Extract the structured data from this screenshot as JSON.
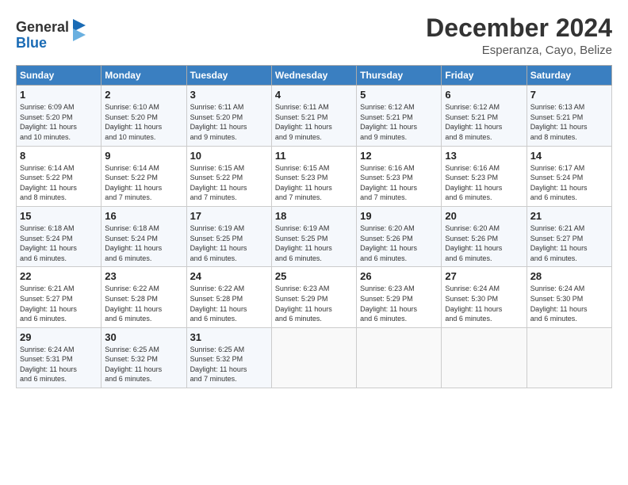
{
  "header": {
    "logo_line1": "General",
    "logo_line2": "Blue",
    "month": "December 2024",
    "location": "Esperanza, Cayo, Belize"
  },
  "days_of_week": [
    "Sunday",
    "Monday",
    "Tuesday",
    "Wednesday",
    "Thursday",
    "Friday",
    "Saturday"
  ],
  "weeks": [
    [
      {
        "day": "1",
        "text": "Sunrise: 6:09 AM\nSunset: 5:20 PM\nDaylight: 11 hours\nand 10 minutes."
      },
      {
        "day": "2",
        "text": "Sunrise: 6:10 AM\nSunset: 5:20 PM\nDaylight: 11 hours\nand 10 minutes."
      },
      {
        "day": "3",
        "text": "Sunrise: 6:11 AM\nSunset: 5:20 PM\nDaylight: 11 hours\nand 9 minutes."
      },
      {
        "day": "4",
        "text": "Sunrise: 6:11 AM\nSunset: 5:21 PM\nDaylight: 11 hours\nand 9 minutes."
      },
      {
        "day": "5",
        "text": "Sunrise: 6:12 AM\nSunset: 5:21 PM\nDaylight: 11 hours\nand 9 minutes."
      },
      {
        "day": "6",
        "text": "Sunrise: 6:12 AM\nSunset: 5:21 PM\nDaylight: 11 hours\nand 8 minutes."
      },
      {
        "day": "7",
        "text": "Sunrise: 6:13 AM\nSunset: 5:21 PM\nDaylight: 11 hours\nand 8 minutes."
      }
    ],
    [
      {
        "day": "8",
        "text": "Sunrise: 6:14 AM\nSunset: 5:22 PM\nDaylight: 11 hours\nand 8 minutes."
      },
      {
        "day": "9",
        "text": "Sunrise: 6:14 AM\nSunset: 5:22 PM\nDaylight: 11 hours\nand 7 minutes."
      },
      {
        "day": "10",
        "text": "Sunrise: 6:15 AM\nSunset: 5:22 PM\nDaylight: 11 hours\nand 7 minutes."
      },
      {
        "day": "11",
        "text": "Sunrise: 6:15 AM\nSunset: 5:23 PM\nDaylight: 11 hours\nand 7 minutes."
      },
      {
        "day": "12",
        "text": "Sunrise: 6:16 AM\nSunset: 5:23 PM\nDaylight: 11 hours\nand 7 minutes."
      },
      {
        "day": "13",
        "text": "Sunrise: 6:16 AM\nSunset: 5:23 PM\nDaylight: 11 hours\nand 6 minutes."
      },
      {
        "day": "14",
        "text": "Sunrise: 6:17 AM\nSunset: 5:24 PM\nDaylight: 11 hours\nand 6 minutes."
      }
    ],
    [
      {
        "day": "15",
        "text": "Sunrise: 6:18 AM\nSunset: 5:24 PM\nDaylight: 11 hours\nand 6 minutes."
      },
      {
        "day": "16",
        "text": "Sunrise: 6:18 AM\nSunset: 5:24 PM\nDaylight: 11 hours\nand 6 minutes."
      },
      {
        "day": "17",
        "text": "Sunrise: 6:19 AM\nSunset: 5:25 PM\nDaylight: 11 hours\nand 6 minutes."
      },
      {
        "day": "18",
        "text": "Sunrise: 6:19 AM\nSunset: 5:25 PM\nDaylight: 11 hours\nand 6 minutes."
      },
      {
        "day": "19",
        "text": "Sunrise: 6:20 AM\nSunset: 5:26 PM\nDaylight: 11 hours\nand 6 minutes."
      },
      {
        "day": "20",
        "text": "Sunrise: 6:20 AM\nSunset: 5:26 PM\nDaylight: 11 hours\nand 6 minutes."
      },
      {
        "day": "21",
        "text": "Sunrise: 6:21 AM\nSunset: 5:27 PM\nDaylight: 11 hours\nand 6 minutes."
      }
    ],
    [
      {
        "day": "22",
        "text": "Sunrise: 6:21 AM\nSunset: 5:27 PM\nDaylight: 11 hours\nand 6 minutes."
      },
      {
        "day": "23",
        "text": "Sunrise: 6:22 AM\nSunset: 5:28 PM\nDaylight: 11 hours\nand 6 minutes."
      },
      {
        "day": "24",
        "text": "Sunrise: 6:22 AM\nSunset: 5:28 PM\nDaylight: 11 hours\nand 6 minutes."
      },
      {
        "day": "25",
        "text": "Sunrise: 6:23 AM\nSunset: 5:29 PM\nDaylight: 11 hours\nand 6 minutes."
      },
      {
        "day": "26",
        "text": "Sunrise: 6:23 AM\nSunset: 5:29 PM\nDaylight: 11 hours\nand 6 minutes."
      },
      {
        "day": "27",
        "text": "Sunrise: 6:24 AM\nSunset: 5:30 PM\nDaylight: 11 hours\nand 6 minutes."
      },
      {
        "day": "28",
        "text": "Sunrise: 6:24 AM\nSunset: 5:30 PM\nDaylight: 11 hours\nand 6 minutes."
      }
    ],
    [
      {
        "day": "29",
        "text": "Sunrise: 6:24 AM\nSunset: 5:31 PM\nDaylight: 11 hours\nand 6 minutes."
      },
      {
        "day": "30",
        "text": "Sunrise: 6:25 AM\nSunset: 5:32 PM\nDaylight: 11 hours\nand 6 minutes."
      },
      {
        "day": "31",
        "text": "Sunrise: 6:25 AM\nSunset: 5:32 PM\nDaylight: 11 hours\nand 7 minutes."
      },
      {
        "day": "",
        "text": ""
      },
      {
        "day": "",
        "text": ""
      },
      {
        "day": "",
        "text": ""
      },
      {
        "day": "",
        "text": ""
      }
    ]
  ]
}
